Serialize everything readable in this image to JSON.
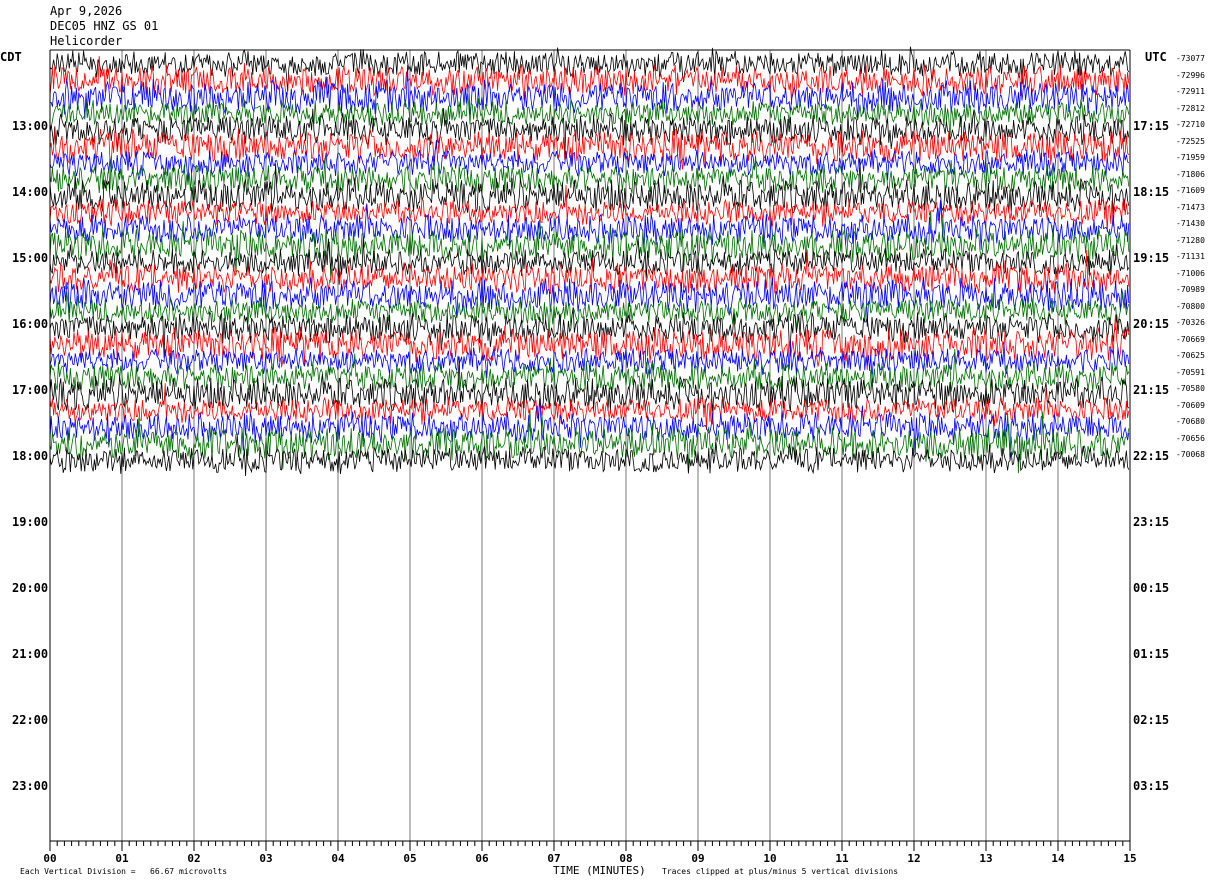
{
  "header": {
    "date": "Apr 9,2026",
    "channel": "DEC05 HNZ GS 01",
    "network": "Helicorder"
  },
  "left_axis_title": "CDT",
  "right_axis_title": "UTC",
  "colors": {
    "cycle": [
      "#000000",
      "#ff0000",
      "#0000ff",
      "#007000"
    ]
  },
  "chart_data": {
    "type": "line",
    "title": "",
    "xlabel": "TIME (MINUTES)",
    "xlim": [
      0,
      15
    ],
    "x_ticks": [
      "00",
      "01",
      "02",
      "03",
      "04",
      "05",
      "06",
      "07",
      "08",
      "09",
      "10",
      "11",
      "12",
      "13",
      "14",
      "15"
    ],
    "left_time_labels": [
      "13:00",
      "14:00",
      "15:00",
      "16:00",
      "17:00",
      "18:00",
      "19:00",
      "20:00",
      "21:00",
      "22:00",
      "23:00"
    ],
    "right_time_labels": [
      "17:15",
      "18:15",
      "19:15",
      "20:15",
      "21:15",
      "22:15",
      "23:15",
      "00:15",
      "01:15",
      "02:15",
      "03:15"
    ],
    "trace_means": [
      "-73077",
      "-72996",
      "-72911",
      "-72812",
      "-72710",
      "-72525",
      "-71959",
      "-71806",
      "-71609",
      "-71473",
      "-71430",
      "-71280",
      "-71131",
      "-71006",
      "-70989",
      "-70800",
      "-70326",
      "-70669",
      "-70625",
      "-70591",
      "-70580",
      "-70609",
      "-70680",
      "-70656",
      "-70068"
    ],
    "rows_recorded": 25,
    "minutes_per_row": 15,
    "vertical_division": "Each Vertical Division =   66.67 microvolts",
    "clip_note": "Traces clipped at plus/minus 5 vertical divisions"
  }
}
